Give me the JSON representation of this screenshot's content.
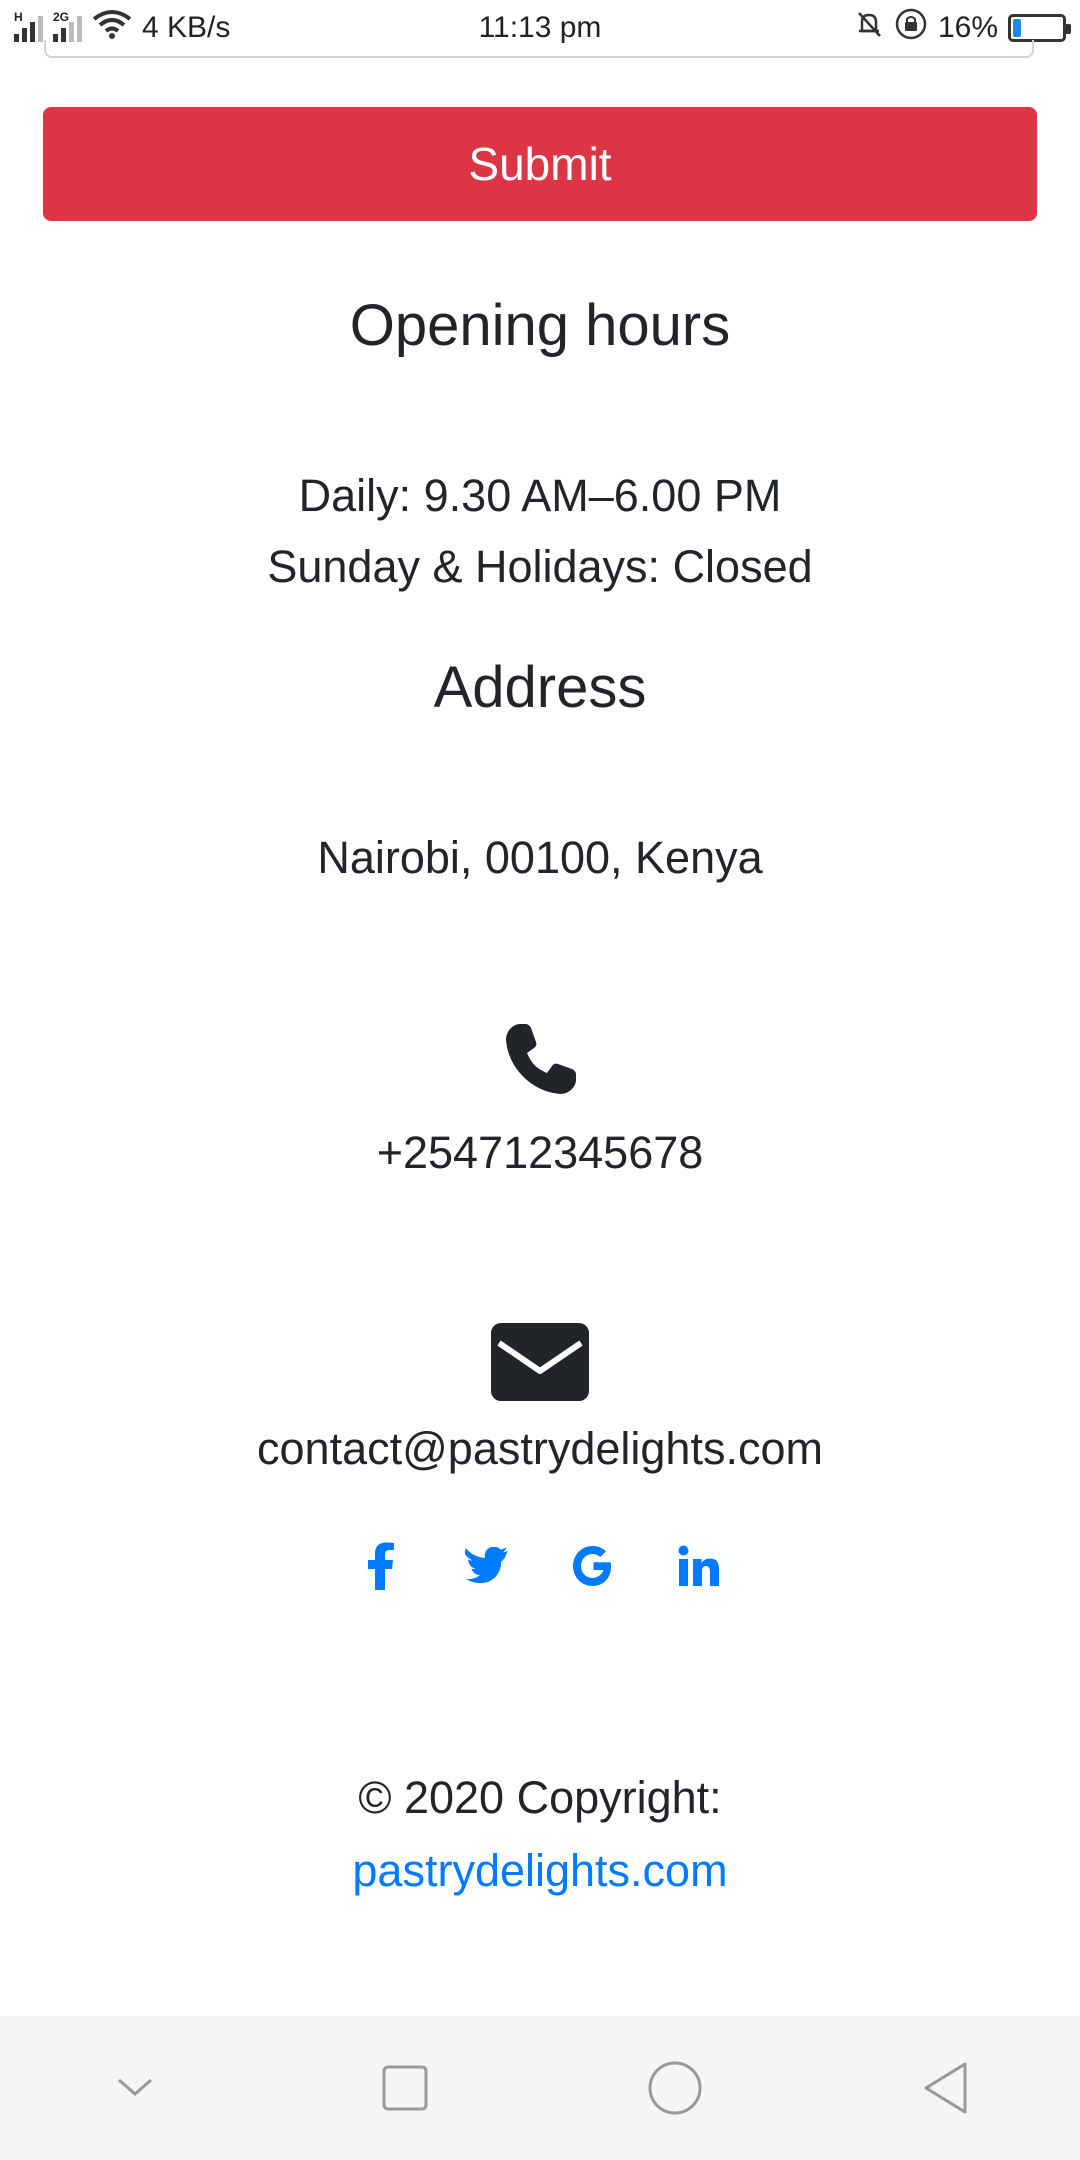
{
  "status_bar": {
    "network_tag_1": "H",
    "network_tag_2": "2G",
    "speed": "4 KB/s",
    "time": "11:13 pm",
    "battery_percent": "16%",
    "battery_level": 0.16
  },
  "form": {
    "submit_label": "Submit"
  },
  "opening_hours": {
    "heading": "Opening hours",
    "daily": "Daily: 9.30 AM–6.00 PM",
    "sunday": "Sunday & Holidays: Closed"
  },
  "address": {
    "heading": "Address",
    "text": "Nairobi, 00100, Kenya"
  },
  "contact": {
    "phone": "+254712345678",
    "email": "contact@pastrydelights.com",
    "phone_icon": "phone-icon",
    "email_icon": "envelope-icon"
  },
  "social": {
    "items": [
      "facebook-icon",
      "twitter-icon",
      "google-icon",
      "linkedin-icon"
    ],
    "color": "#007bff"
  },
  "footer": {
    "copyright": "© 2020 Copyright:",
    "link": "pastrydelights.com"
  },
  "colors": {
    "submit_bg": "#dc3545",
    "link": "#007bff",
    "text": "#212529"
  }
}
